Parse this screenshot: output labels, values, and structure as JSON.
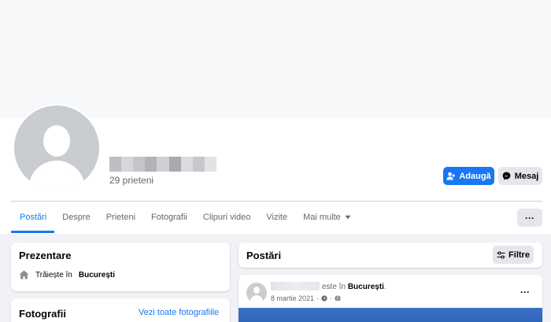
{
  "profile": {
    "friends": "29 prieteni",
    "add_button": "Adaugă",
    "message_button": "Mesaj",
    "name_blur_colors": [
      "#bdbec2",
      "#d6d7da",
      "#c4c5c8",
      "#b2b3b6",
      "#cfd0d3",
      "#a9aaad",
      "#dadbde",
      "#c7c8cb",
      "#e2e3e6"
    ]
  },
  "tabs": [
    {
      "label": "Postări",
      "active": true
    },
    {
      "label": "Despre",
      "active": false
    },
    {
      "label": "Prieteni",
      "active": false
    },
    {
      "label": "Fotografii",
      "active": false
    },
    {
      "label": "Clipuri video",
      "active": false
    },
    {
      "label": "Vizite",
      "active": false
    },
    {
      "label": "Mai multe",
      "active": false
    }
  ],
  "more_actions": "···",
  "intro": {
    "title": "Prezentare",
    "lives_prefix": "Trăiește în",
    "lives_city": "București"
  },
  "photos": {
    "title": "Fotografii",
    "see_all": "Vezi toate fotografiile"
  },
  "posts": {
    "title": "Postări",
    "filter": "Filtre"
  },
  "post": {
    "text_prefix": "este în",
    "city": "București",
    "date": "8 martie 2021",
    "dots": "···"
  },
  "colors": {
    "accent": "#1877f2",
    "secondary_text": "#65676b",
    "button_gray": "#e4e6eb"
  },
  "icons": {
    "add_friend": "add-friend-icon",
    "messenger": "messenger-icon",
    "dropdown": "chevron-down-icon",
    "home": "home-icon",
    "filter": "sliders-icon",
    "privacy": "globe-icon"
  }
}
